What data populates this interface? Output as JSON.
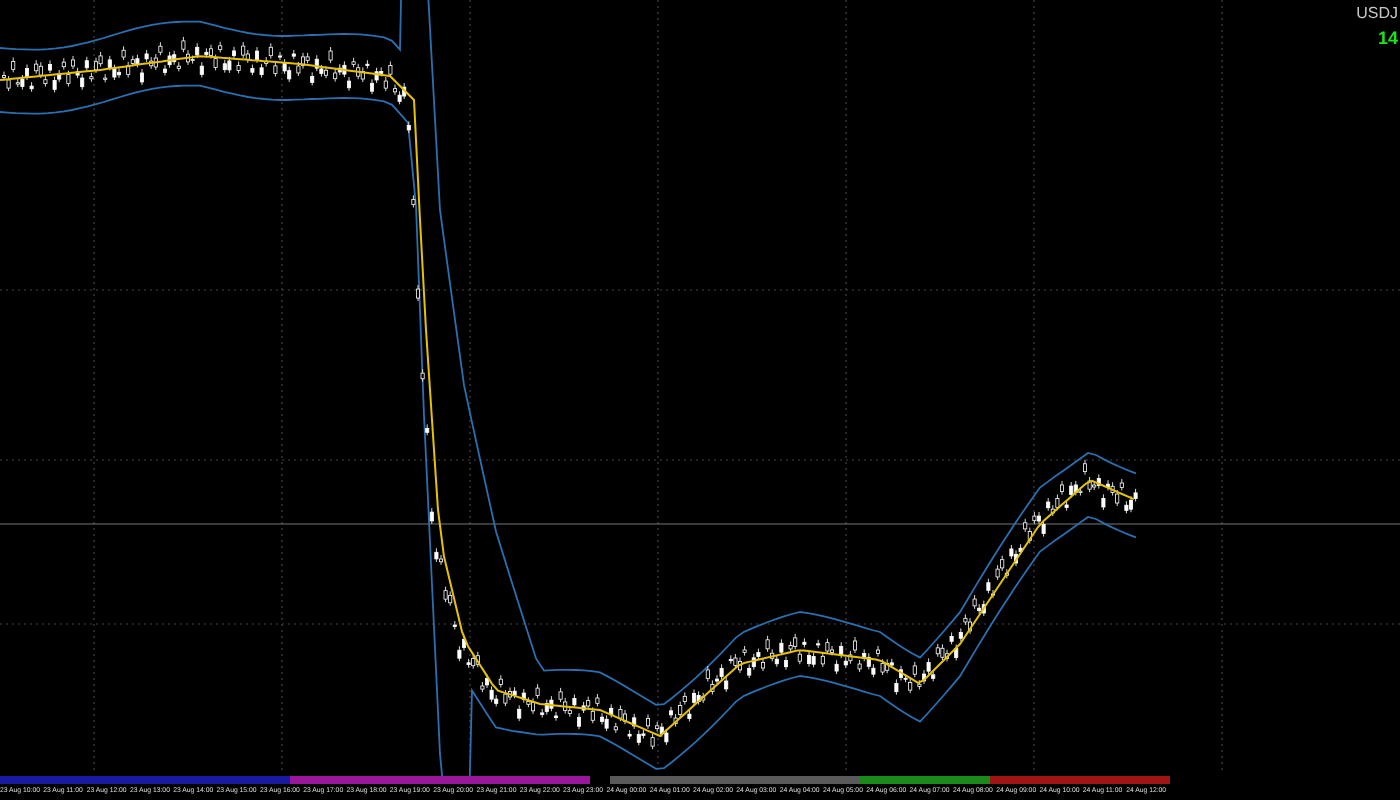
{
  "symbol": {
    "label": "USDJ"
  },
  "price": {
    "label": "14"
  },
  "time_axis": {
    "labels": [
      "23 Aug 10:00",
      "23 Aug 11:00",
      "23 Aug 12:00",
      "23 Aug 13:00",
      "23 Aug 14:00",
      "23 Aug 15:00",
      "23 Aug 16:00",
      "23 Aug 17:00",
      "23 Aug 18:00",
      "23 Aug 19:00",
      "23 Aug 20:00",
      "23 Aug 21:00",
      "23 Aug 22:00",
      "23 Aug 23:00",
      "24 Aug 00:00",
      "24 Aug 01:00",
      "24 Aug 02:00",
      "24 Aug 03:00",
      "24 Aug 04:00",
      "24 Aug 05:00",
      "24 Aug 06:00",
      "24 Aug 07:00",
      "24 Aug 08:00",
      "24 Aug 09:00",
      "24 Aug 10:00",
      "24 Aug 11:00",
      "24 Aug 12:00"
    ]
  }
}
